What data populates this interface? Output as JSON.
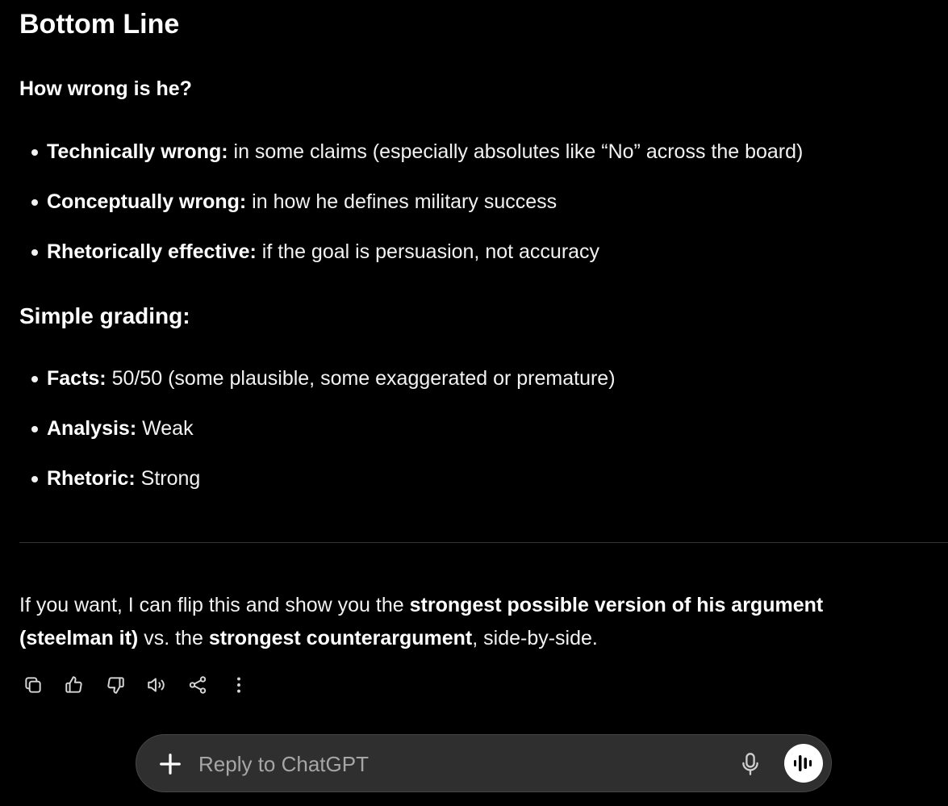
{
  "response": {
    "title": "Bottom Line",
    "question": "How wrong is he?",
    "assessment": [
      {
        "label": "Technically wrong:",
        "text": " in some claims (especially absolutes like “No” across the board)"
      },
      {
        "label": "Conceptually wrong:",
        "text": " in how he defines military success"
      },
      {
        "label": "Rhetorically effective:",
        "text": " if the goal is persuasion, not accuracy"
      }
    ],
    "grading_title": "Simple grading:",
    "grading": [
      {
        "label": "Facts:",
        "text": " 50/50 (some plausible, some exaggerated or premature)"
      },
      {
        "label": "Analysis:",
        "text": " Weak"
      },
      {
        "label": "Rhetoric:",
        "text": " Strong"
      }
    ],
    "followup": {
      "p1": "If you want, I can flip this and show you the ",
      "b1": "strongest possible version of his argument (steelman it)",
      "p2": " vs. the ",
      "b2": "strongest counterargument",
      "p3": ", side-by-side."
    }
  },
  "actions": [
    "copy-icon",
    "thumbs-up-icon",
    "thumbs-down-icon",
    "read-aloud-icon",
    "share-icon",
    "more-options-icon"
  ],
  "composer": {
    "placeholder": "Reply to ChatGPT"
  },
  "colors": {
    "background": "#000000",
    "text": "#f2f2f2",
    "composer_bg": "#2f2f2f",
    "divider": "#333333"
  }
}
